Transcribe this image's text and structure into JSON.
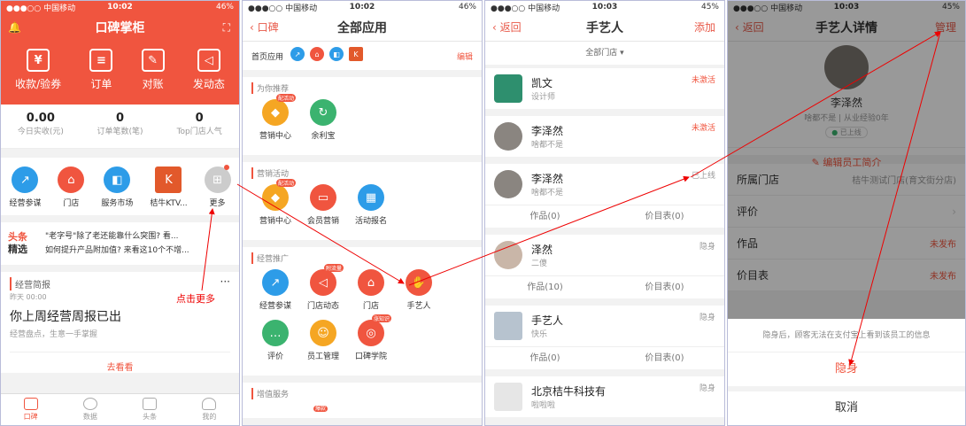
{
  "status": {
    "carrier": "●●●○○ 中国移动",
    "t1": "10:02",
    "t2": "10:02",
    "t3": "10:03",
    "t4": "10:03",
    "batt1": "46%",
    "batt3": "45%"
  },
  "p1": {
    "title": "口碑掌柜",
    "quick": [
      "收款/验券",
      "订单",
      "对账",
      "发动态"
    ],
    "stats": [
      {
        "v": "0.00",
        "l": "今日实收(元)"
      },
      {
        "v": "0",
        "l": "订单笔数(笔)"
      },
      {
        "v": "0",
        "l": "Top门店人气"
      }
    ],
    "apps": [
      "经营参谋",
      "门店",
      "服务市场",
      "桔牛KTV...",
      "更多"
    ],
    "news_tag1": "头条",
    "news_tag2": "精选",
    "news1": "\"老字号\"除了老还能靠什么突围? 看...",
    "news2": "如何提升产品附加值? 来看这10个不增...",
    "weekly_title": "经营简报",
    "weekly_date": "昨天 00:00",
    "weekly_head": "你上周经营周报已出",
    "weekly_sub": "经营盘点，生意一手掌握",
    "weekly_btn": "去看看",
    "tabs": [
      "口碑",
      "数据",
      "头条",
      "我的"
    ],
    "note": "点击更多"
  },
  "p2": {
    "back": "口碑",
    "title": "全部应用",
    "home": "首页应用",
    "edit": "编辑",
    "s1": "为你推荐",
    "s1a": [
      "营销中心",
      "余利宝"
    ],
    "s2": "营销活动",
    "s2a": [
      "营销中心",
      "会员营销",
      "活动报名"
    ],
    "s3": "经营推广",
    "s3a": [
      "经营参谋",
      "门店动态",
      "门店",
      "手艺人",
      "评价",
      "员工管理",
      "口碑学院"
    ],
    "s4": "增值服务",
    "b_active": "配活动",
    "b_flow": "附流量",
    "b_know": "涨知识",
    "b_hot": "爆款"
  },
  "p3": {
    "back": "返回",
    "title": "手艺人",
    "add": "添加",
    "filter": "全部门店",
    "people": [
      {
        "n": "凯文",
        "s": "设计师",
        "st": "未激活"
      },
      {
        "n": "李泽然",
        "s": "啥都不是",
        "st": "未激活"
      },
      {
        "n": "李泽然",
        "s": "啥都不是",
        "st": "已上线",
        "w": "作品(0)",
        "p": "价目表(0)"
      },
      {
        "n": "泽然",
        "s": "二傻",
        "st": "隐身",
        "w": "作品(10)",
        "p": "价目表(0)"
      },
      {
        "n": "手艺人",
        "s": "快乐",
        "st": "隐身",
        "w": "作品(0)",
        "p": "价目表(0)"
      },
      {
        "n": "北京桔牛科技有",
        "s": "啦啦啦",
        "st": "隐身"
      }
    ]
  },
  "p4": {
    "back": "返回",
    "title": "手艺人详情",
    "manage": "管理",
    "name": "李泽然",
    "desc": "啥都不是 | 从业经验0年",
    "online": "已上线",
    "edit": "编辑员工简介",
    "rows": [
      {
        "k": "所属门店",
        "v": "桔牛测试门店(育文街分店)"
      },
      {
        "k": "评价",
        "v": ""
      },
      {
        "k": "作品",
        "v": "未发布"
      },
      {
        "k": "价目表",
        "v": "未发布"
      }
    ],
    "hint": "隐身后，顾客无法在支付宝上看到该员工的信息",
    "hide": "隐身",
    "cancel": "取消"
  },
  "colors": {
    "red": "#f0553f",
    "blue": "#2d9ce8",
    "green": "#3bb36f",
    "orange": "#f5a623"
  }
}
